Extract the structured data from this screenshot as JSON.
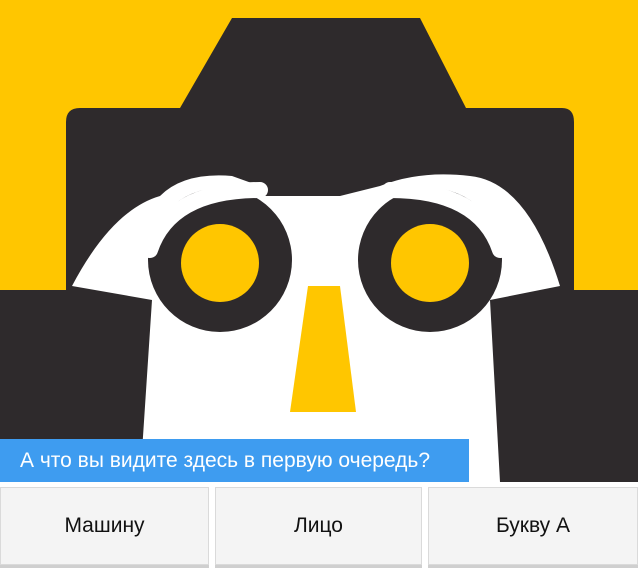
{
  "image": {
    "colors": {
      "background": "#ffc600",
      "dark": "#2e2a2c",
      "light": "#ffffff"
    }
  },
  "caption": {
    "text": "А что вы видите здесь в первую очередь?",
    "close_label": "x",
    "background": "#3e9cf0"
  },
  "answers": [
    {
      "label": "Машину"
    },
    {
      "label": "Лицо"
    },
    {
      "label": "Букву А"
    }
  ]
}
